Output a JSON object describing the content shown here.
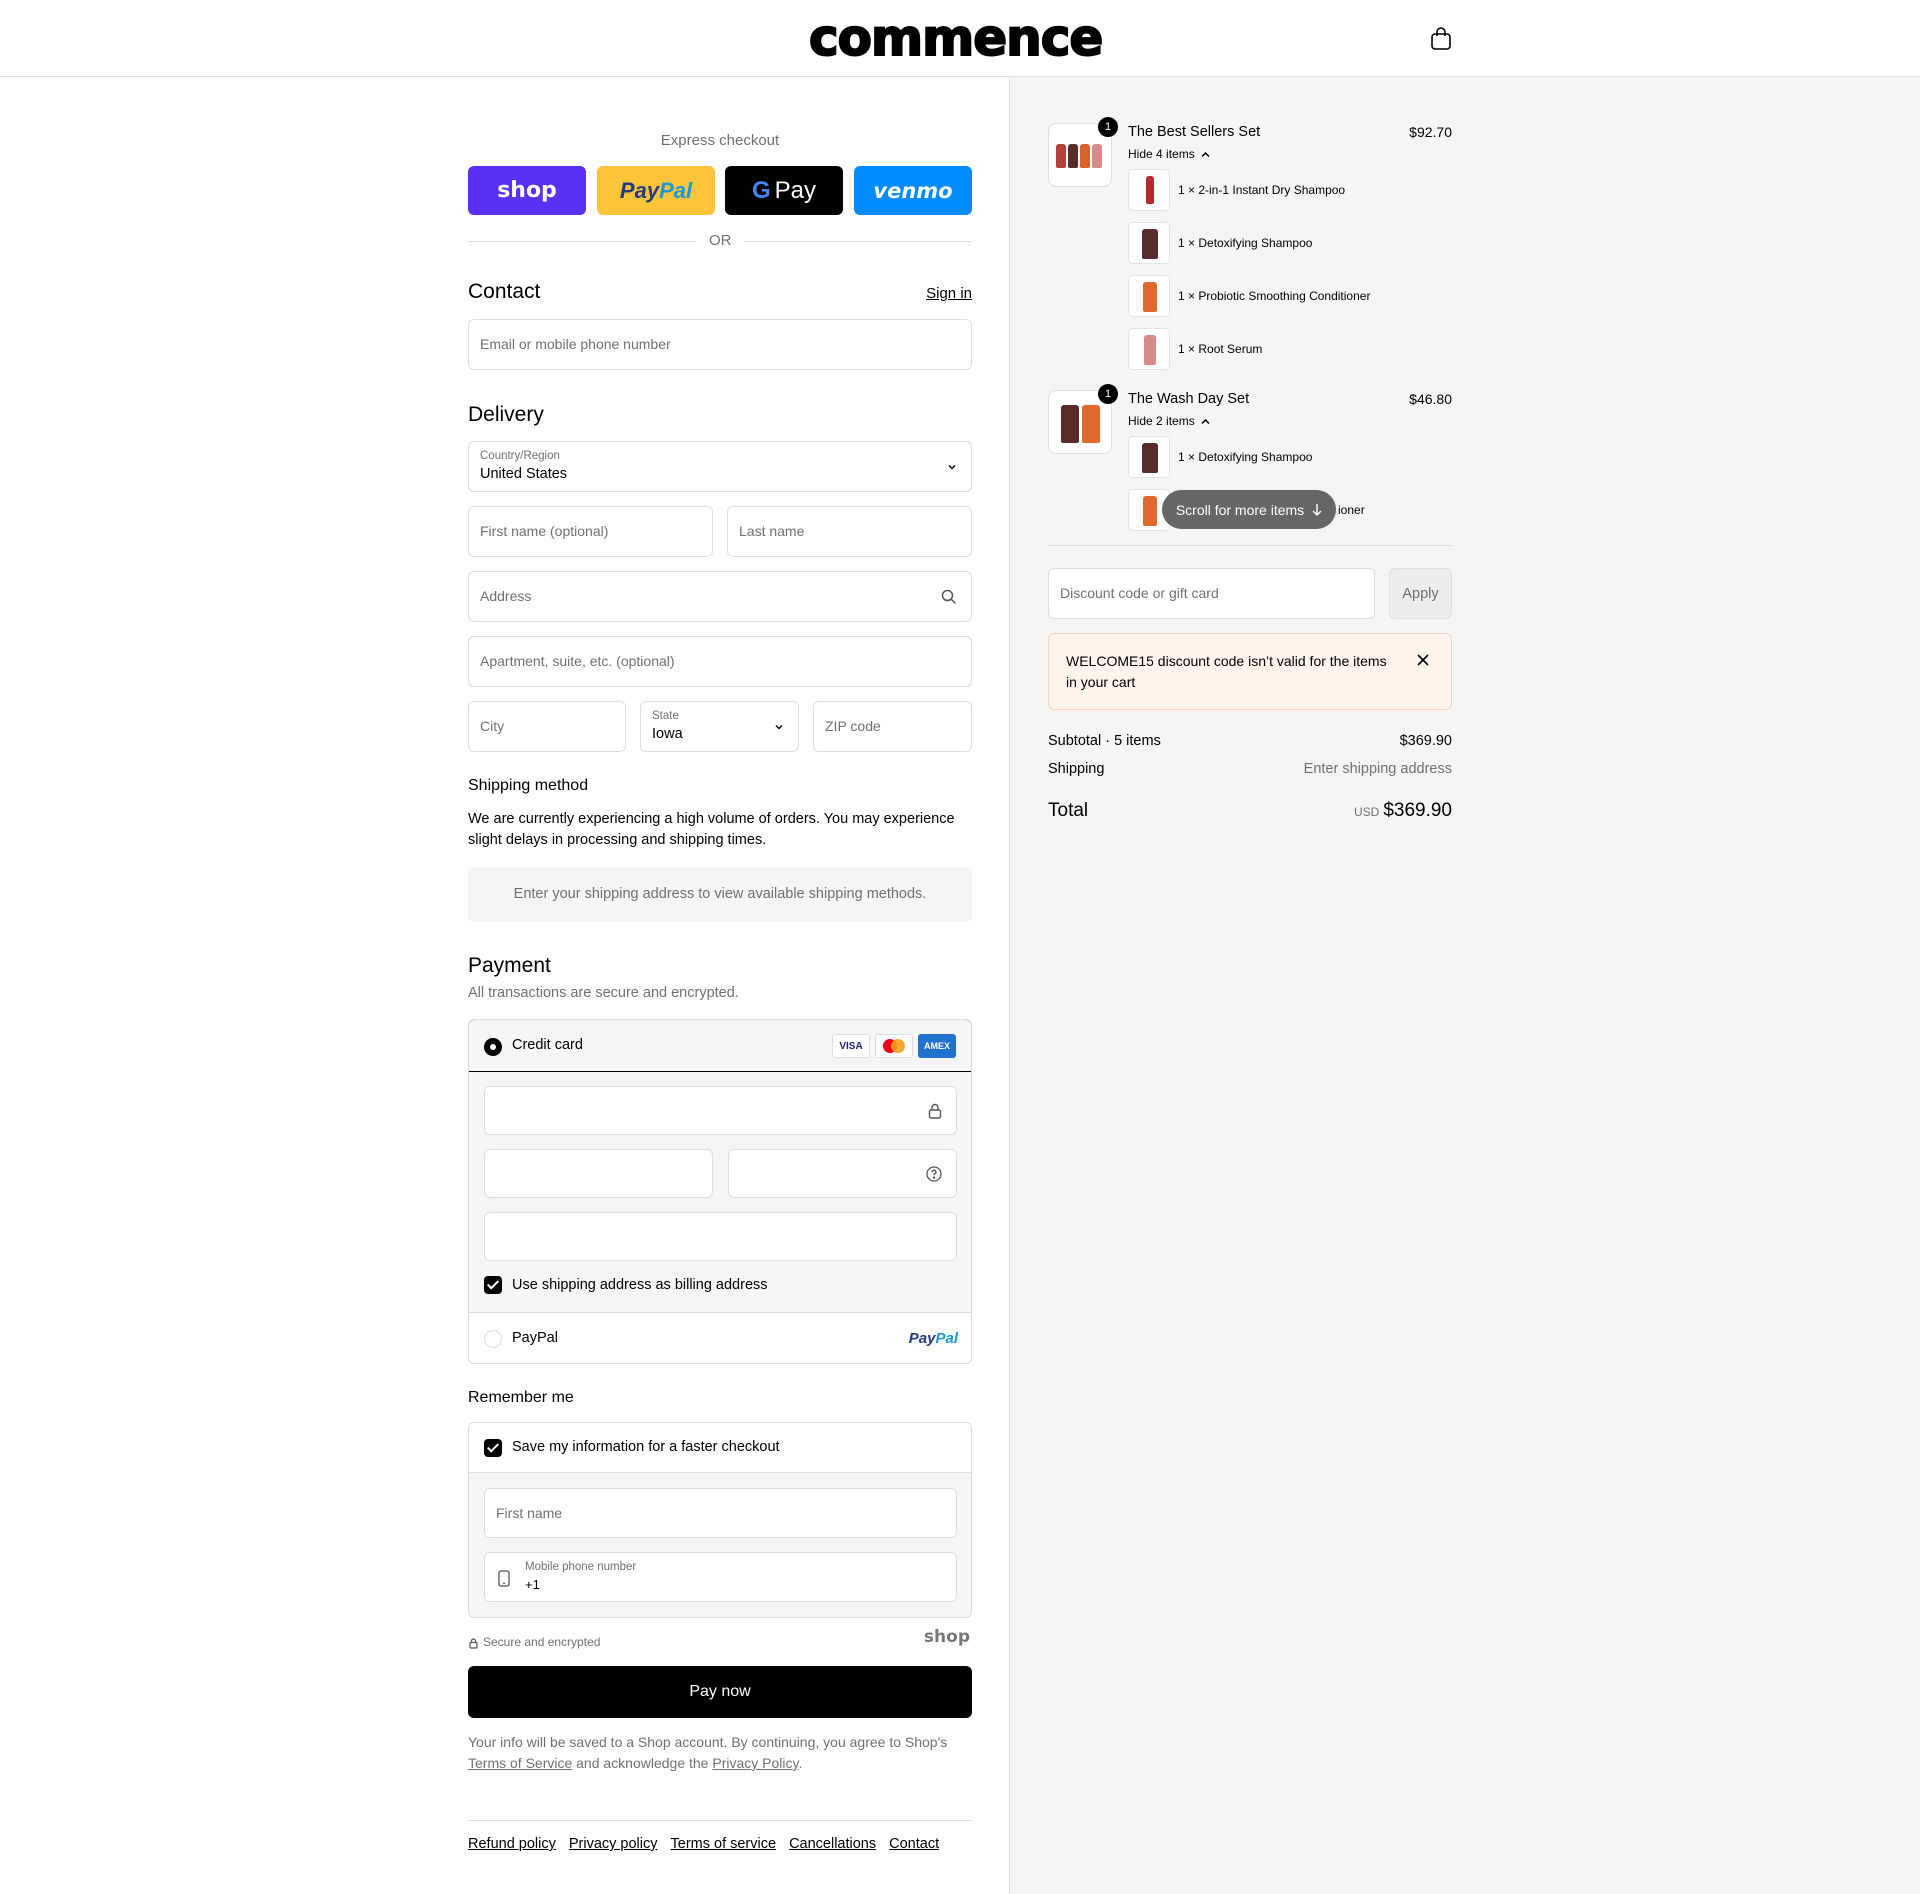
{
  "header": {
    "logo": "commence",
    "cart_icon": "shopping-bag-icon"
  },
  "express": {
    "title": "Express checkout",
    "shop_label": "shop",
    "paypal_label": "PayPal",
    "gpay_g": "G",
    "gpay_label": "Pay",
    "venmo_label": "venmo",
    "or": "OR"
  },
  "contact": {
    "heading": "Contact",
    "sign_in": "Sign in",
    "email_placeholder": "Email or mobile phone number"
  },
  "delivery": {
    "heading": "Delivery",
    "country_label": "Country/Region",
    "country_value": "United States",
    "first_name_placeholder": "First name (optional)",
    "last_name_placeholder": "Last name",
    "address_placeholder": "Address",
    "apartment_placeholder": "Apartment, suite, etc. (optional)",
    "city_placeholder": "City",
    "state_label": "State",
    "state_value": "Iowa",
    "zip_placeholder": "ZIP code"
  },
  "shipping": {
    "heading": "Shipping method",
    "notice": "We are currently experiencing a high volume of orders. You may experience slight delays in processing and shipping times.",
    "placeholder_box": "Enter your shipping address to view available shipping methods."
  },
  "payment": {
    "heading": "Payment",
    "subtitle": "All transactions are secure and encrypted.",
    "credit_card_label": "Credit card",
    "card_brands": [
      "VISA",
      "Mastercard",
      "AMEX"
    ],
    "billing_checkbox": "Use shipping address as billing address",
    "paypal_label": "PayPal",
    "paypal_logo": "PayPal"
  },
  "remember": {
    "heading": "Remember me",
    "save_checkbox": "Save my information for a faster checkout",
    "first_name_placeholder": "First name",
    "phone_label": "Mobile phone number",
    "phone_value": "+1",
    "secure_text": "Secure and encrypted",
    "shop_logo": "shop"
  },
  "pay_now": "Pay now",
  "legal": {
    "prefix": "Your info will be saved to a Shop account. By continuing, you agree to Shop's",
    "terms": "Terms of Service",
    "middle": "and acknowledge the",
    "privacy": "Privacy Policy",
    "suffix": "."
  },
  "footer": {
    "links": [
      "Refund policy",
      "Privacy policy",
      "Terms of service",
      "Cancellations",
      "Contact"
    ]
  },
  "order": {
    "items": [
      {
        "title": "The Best Sellers Set",
        "price": "$92.70",
        "qty": "1",
        "toggle": "Hide 4 items",
        "sub_items": [
          "1 × 2-in-1 Instant Dry Shampoo",
          "1 × Detoxifying Shampoo",
          "1 × Probiotic Smoothing Conditioner",
          "1 × Root Serum"
        ]
      },
      {
        "title": "The Wash Day Set",
        "price": "$46.80",
        "qty": "1",
        "toggle": "Hide 2 items",
        "sub_items": [
          "1 × Detoxifying Shampoo",
          "ioner"
        ]
      }
    ],
    "scroll_hint": "Scroll for more items",
    "discount_placeholder": "Discount code or gift card",
    "apply": "Apply",
    "warning": "WELCOME15 discount code isn’t valid for the items in your cart",
    "subtotal_label": "Subtotal · 5 items",
    "subtotal_value": "$369.90",
    "shipping_label": "Shipping",
    "shipping_value": "Enter shipping address",
    "total_label": "Total",
    "currency": "USD",
    "total_value": "$369.90"
  },
  "colors": {
    "shop_purple": "#5a31f4",
    "paypal_yellow": "#ffc439",
    "venmo_blue": "#008cff",
    "warning_bg": "#fff5eb"
  }
}
